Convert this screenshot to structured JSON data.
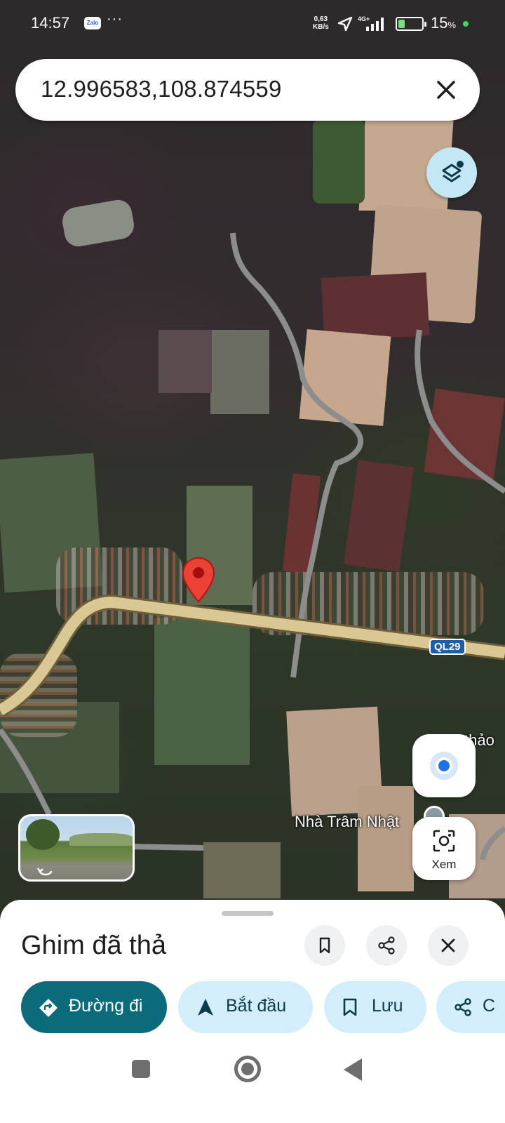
{
  "status_bar": {
    "time": "14:57",
    "app_notification": "Zalo",
    "more_dots": "···",
    "net_speed_value": "0,63",
    "net_speed_unit": "KB/s",
    "network_type": "4G+",
    "battery_percent": "15",
    "battery_unit": "%",
    "battery_level": 0.15
  },
  "search": {
    "query": "12.996583,108.874559",
    "clear_icon": "close-icon"
  },
  "map": {
    "route_shield": "QL29",
    "place_label": "Nhà Trâm Nhật",
    "partial_label": "thảo",
    "pin_color": "#ea4335",
    "major_road_color": "#d9c893",
    "minor_road_color": "#8d8d8d"
  },
  "buttons": {
    "layers_icon": "layers-icon",
    "my_location_icon": "my-location-icon",
    "lens_label": "Xem",
    "lens_icon": "camera-lens-icon"
  },
  "sheet": {
    "title": "Ghim đã thả",
    "save_icon": "bookmark-icon",
    "share_icon": "share-icon",
    "close_icon": "close-icon",
    "chips": [
      {
        "label": "Đường đi",
        "icon": "directions-icon"
      },
      {
        "label": "Bắt đầu",
        "icon": "navigation-arrow-icon"
      },
      {
        "label": "Lưu",
        "icon": "bookmark-icon"
      },
      {
        "label": "C",
        "icon": "share-icon"
      }
    ],
    "accent_color": "#0b6b7a",
    "chip_color": "#d3eefb"
  },
  "nav_bar": {
    "recents_icon": "recents-square-icon",
    "home_icon": "home-circle-icon",
    "back_icon": "back-triangle-icon"
  }
}
